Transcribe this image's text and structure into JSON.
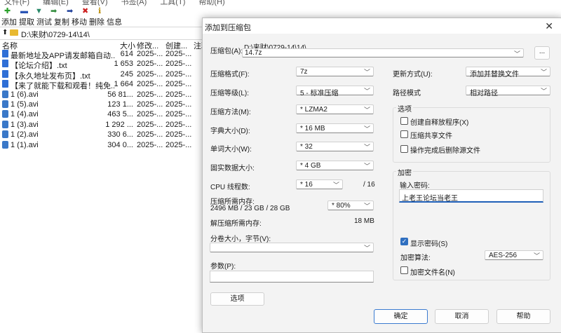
{
  "background": {
    "menu": [
      "文件(F)",
      "编辑(E)",
      "查看(V)",
      "书签(A)",
      "工具(T)",
      "帮助(H)"
    ],
    "toolbar": [
      "添加",
      "提取",
      "测试",
      "复制",
      "移动",
      "删除",
      "信息"
    ],
    "path": "D:\\来财\\0729-14\\14\\",
    "columns": [
      "名称",
      "大小",
      "修改...",
      "创建...",
      "注释"
    ],
    "files": [
      {
        "name": "最新地址及APP请发邮箱自动...",
        "size": "614",
        "modified": "2025-...",
        "created": "2025-...",
        "type": "txt"
      },
      {
        "name": "【论坛介绍】.txt",
        "size": "1 653",
        "modified": "2025-...",
        "created": "2025-...",
        "type": "txt"
      },
      {
        "name": "【永久地址发布页】.txt",
        "size": "245",
        "modified": "2025-...",
        "created": "2025-...",
        "type": "txt"
      },
      {
        "name": "【来了就能下载和观看！纯免...",
        "size": "1 664",
        "modified": "2025-...",
        "created": "2025-...",
        "type": "txt"
      },
      {
        "name": "1 (6).avi",
        "size": "56 81...",
        "modified": "2025-...",
        "created": "2025-...",
        "type": "avi"
      },
      {
        "name": "1 (5).avi",
        "size": "123 1...",
        "modified": "2025-...",
        "created": "2025-...",
        "type": "avi"
      },
      {
        "name": "1 (4).avi",
        "size": "463 5...",
        "modified": "2025-...",
        "created": "2025-...",
        "type": "avi"
      },
      {
        "name": "1 (3).avi",
        "size": "1 292 ...",
        "modified": "2025-...",
        "created": "2025-...",
        "type": "avi"
      },
      {
        "name": "1 (2).avi",
        "size": "330 6...",
        "modified": "2025-...",
        "created": "2025-...",
        "type": "avi"
      },
      {
        "name": "1 (1).avi",
        "size": "304 0...",
        "modified": "2025-...",
        "created": "2025-...",
        "type": "avi"
      }
    ]
  },
  "dialog": {
    "title": "添加到压缩包",
    "close": "✕",
    "archive_label": "压缩包(A):",
    "archive_dir": "D:\\来财\\0729-14\\14\\",
    "archive_name": "14.7z",
    "browse": "...",
    "format_label": "压缩格式(F):",
    "format_value": "7z",
    "level_label": "压缩等级(L):",
    "level_value": "5 - 标准压缩",
    "method_label": "压缩方法(M):",
    "method_value": "*  LZMA2",
    "dict_label": "字典大小(D):",
    "dict_value": "*  16 MB",
    "word_label": "单词大小(W):",
    "word_value": "*  32",
    "solid_label": "固实数据大小:",
    "solid_value": "*  4 GB",
    "cpu_label": "CPU 线程数:",
    "cpu_value": "*  16",
    "cpu_total": "/ 16",
    "mem_label": "压缩所需内存:",
    "mem_value": "2496 MB / 23 GB / 28 GB",
    "mem_percent": "* 80%",
    "decomp_label": "解压缩所需内存:",
    "decomp_value": "18 MB",
    "split_label": "分卷大小，字节(V):",
    "split_value": "",
    "params_label": "参数(P):",
    "options_btn": "选项",
    "update_label": "更新方式(U):",
    "update_value": "添加并替换文件",
    "pathmode_label": "路径模式",
    "pathmode_value": "相对路径",
    "options_group": "选项",
    "opt_sfx": "创建自释放程序(X)",
    "opt_shared": "压缩共享文件",
    "opt_delete": "操作完成后删除源文件",
    "encrypt_group": "加密",
    "pw_label": "输入密码:",
    "pw_value": "上老王论坛当老王",
    "show_pw": "显示密码(S)",
    "enc_method_label": "加密算法:",
    "enc_method_value": "AES-256",
    "enc_names": "加密文件名(N)",
    "ok": "确定",
    "cancel": "取消",
    "help": "帮助"
  }
}
